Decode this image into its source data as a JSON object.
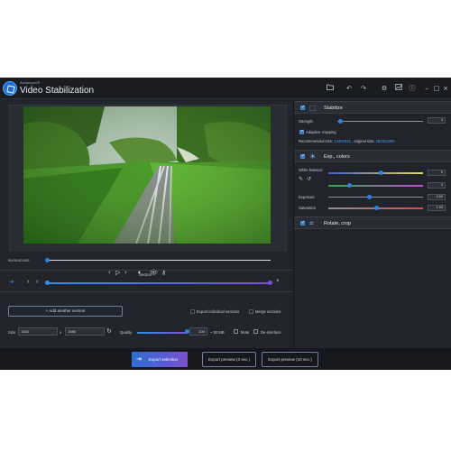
{
  "app": {
    "brand": "Ashampoo®",
    "title": "Video Stabilization"
  },
  "toolbar": {
    "folder_icon": "folder-icon",
    "undo_icon": "undo-icon",
    "redo_icon": "redo-icon",
    "settings_icon": "gear-icon",
    "chart_icon": "chart-icon",
    "info_icon": "info-icon",
    "minimize": "–",
    "maximize": "□",
    "close": "×"
  },
  "player": {
    "prev": "‹",
    "play": "▷",
    "next": "›",
    "timecode": "00:00:00.000",
    "position_fraction": 0.0
  },
  "section": {
    "label": "Section",
    "add_label": "+ Add another section",
    "export_individual": "Export individual sections",
    "merge_sections": "Merge sections"
  },
  "output": {
    "size_label": "Size",
    "width": "1920",
    "times": "x",
    "height": "1080",
    "quality_label": "Quality",
    "quality_value": "100",
    "quality_fraction": 1.0,
    "file_size": "~ 50 MB",
    "mute_label": "Mute",
    "deinterlace_label": "De-interlace"
  },
  "stabilize": {
    "title": "Stabilize",
    "strength_label": "Strength",
    "strength_value": "4",
    "strength_fraction": 0.04,
    "adaptive_label": "Adaptive cropping",
    "recommended_label": "Recommended size:",
    "recommended_value": "1440x810",
    "original_label": ", original size:",
    "original_value": "1920x1080"
  },
  "exp_colors": {
    "title": "Exp., colors",
    "white_balance_label": "White balance",
    "wb1_value": "0",
    "wb2_value": "0",
    "exposure_label": "Exposure",
    "exposure_value": "-0.60",
    "saturation_label": "Saturation",
    "saturation_value": "1.00"
  },
  "rotate": {
    "title": "Rotate, crop"
  },
  "actions": {
    "export_selection": "Export selection",
    "export_preview_3": "Export preview (3 sec.)",
    "export_preview_10": "Export preview (10 sec.)"
  },
  "colors": {
    "accent": "#2b6fd6",
    "accent2": "#7a4fd0",
    "bg": "#23252d"
  }
}
